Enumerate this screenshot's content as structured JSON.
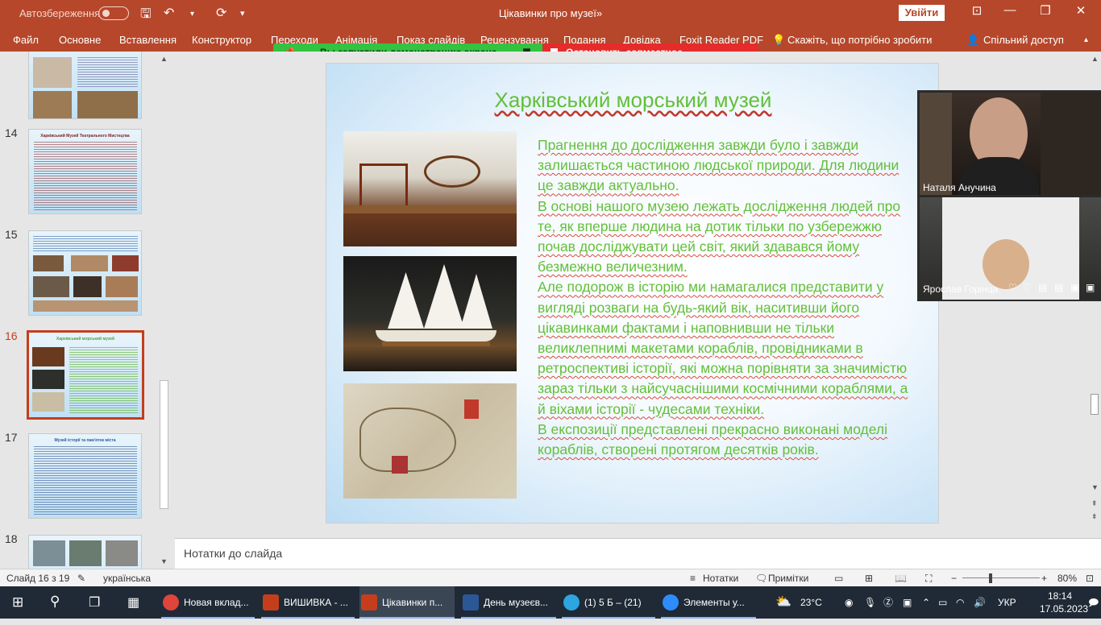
{
  "titlebar": {
    "autosave": "Автозбереження",
    "document_title": "Цікавинки про музеї»",
    "signin": "Увійти"
  },
  "ribbon": {
    "tabs": [
      "Файл",
      "Основне",
      "Вставлення",
      "Конструктор",
      "Переходи",
      "Анімація",
      "Показ слайдів",
      "Рецензування",
      "Подання",
      "Довідка",
      "Foxit Reader PDF"
    ],
    "search_hint": "Скажіть, що потрібно зробити",
    "share": "Спільний доступ"
  },
  "share_banner": {
    "status": "Вы запустили демонстрацию экрана",
    "stop": "Остановить совместное использование"
  },
  "thumbnails": {
    "numbers": [
      "14",
      "15",
      "16",
      "17",
      "18"
    ],
    "slide14_title": "Харківський Музей Театрального Мистецтва",
    "slide16_title": "Харківський морський музей",
    "slide17_title": "Музей історії та пам'яток міста"
  },
  "slide": {
    "title": "Харківський морський музей",
    "paragraphs": [
      "Прагнення до дослідження завжди було і завжди залишається частиною людської природи. Для людини це завжди актуально.",
      "В основі нашого музею лежать дослідження людей про те, як вперше людина на дотик тільки по узбережжю почав досліджувати цей світ, який здавався йому безмежно величезним.",
      "Але подорож в історію ми намагалися представити у вигляді розваги на будь-який вік, наситивши його цікавинками фактами і наповнивши не тільки великлепнимі макетами кораблів, провідниками в ретроспективі історії, які можна порівняти за значимістю зараз тільки з найсучаснішими космічними кораблями, а й віхами історії - чудесами техніки.",
      "В експозиції представлені прекрасно виконані моделі кораблів, створені протягом десятків років."
    ]
  },
  "notes": {
    "placeholder": "Нотатки до слайда"
  },
  "video": {
    "participant1": "Наталя Анучина",
    "participant2": "Ярослав Горінца"
  },
  "statusbar": {
    "slide_counter": "Слайд 16 з 19",
    "language": "українська",
    "notes_btn": "Нотатки",
    "comments_btn": "Примітки",
    "zoom": "80%"
  },
  "taskbar": {
    "apps": [
      {
        "label": "Новая вклад...",
        "color": "#e0443a"
      },
      {
        "label": "ВИШИВКА - ...",
        "color": "#c43e1c"
      },
      {
        "label": "Цікавинки п...",
        "color": "#c43e1c"
      },
      {
        "label": "День музеєв...",
        "color": "#2b5797"
      },
      {
        "label": "(1) 5 Б – (21)",
        "color": "#2ca5e0"
      },
      {
        "label": "Элементы у...",
        "color": "#2d8cff"
      }
    ],
    "weather": "23°C",
    "lang": "УКР",
    "time": "18:14",
    "date": "17.05.2023"
  }
}
